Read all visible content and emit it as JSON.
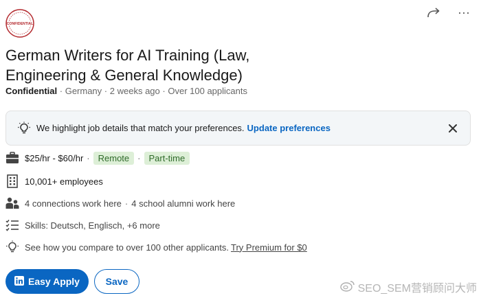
{
  "company_logo": {
    "name": "confidential-logo-icon",
    "text": "CONFIDENTIAL"
  },
  "actions": {
    "share_icon": "share-arrow-icon",
    "more_icon": "more-horizontal-icon",
    "more_label": "···"
  },
  "job": {
    "title": "German Writers for AI Training (Law, Engineering & General Knowledge)",
    "company": "Confidential",
    "location": "Germany",
    "posted": "2 weeks ago",
    "applicants": "Over 100 applicants",
    "separator": "·"
  },
  "banner": {
    "text": "We highlight job details that match your preferences.",
    "link": "Update preferences"
  },
  "details": {
    "salary": "$25/hr - $60/hr",
    "workplace": "Remote",
    "job_type": "Part-time",
    "employees": "10,001+ employees",
    "connections": "4 connections work here",
    "alumni": "4 school alumni work here",
    "skills": "Skills: Deutsch, Englisch, +6 more",
    "compare": "See how you compare to over 100 other applicants.",
    "premium_link": "Try Premium for $0"
  },
  "buttons": {
    "apply": "Easy Apply",
    "save": "Save"
  },
  "watermark": {
    "text": "SEO_SEM营销顾问大师"
  },
  "colors": {
    "brand_blue": "#0a66c2",
    "pill_green_bg": "#ddefd7",
    "pill_green_text": "#2f6b2a",
    "banner_bg": "#f3f6f8"
  }
}
